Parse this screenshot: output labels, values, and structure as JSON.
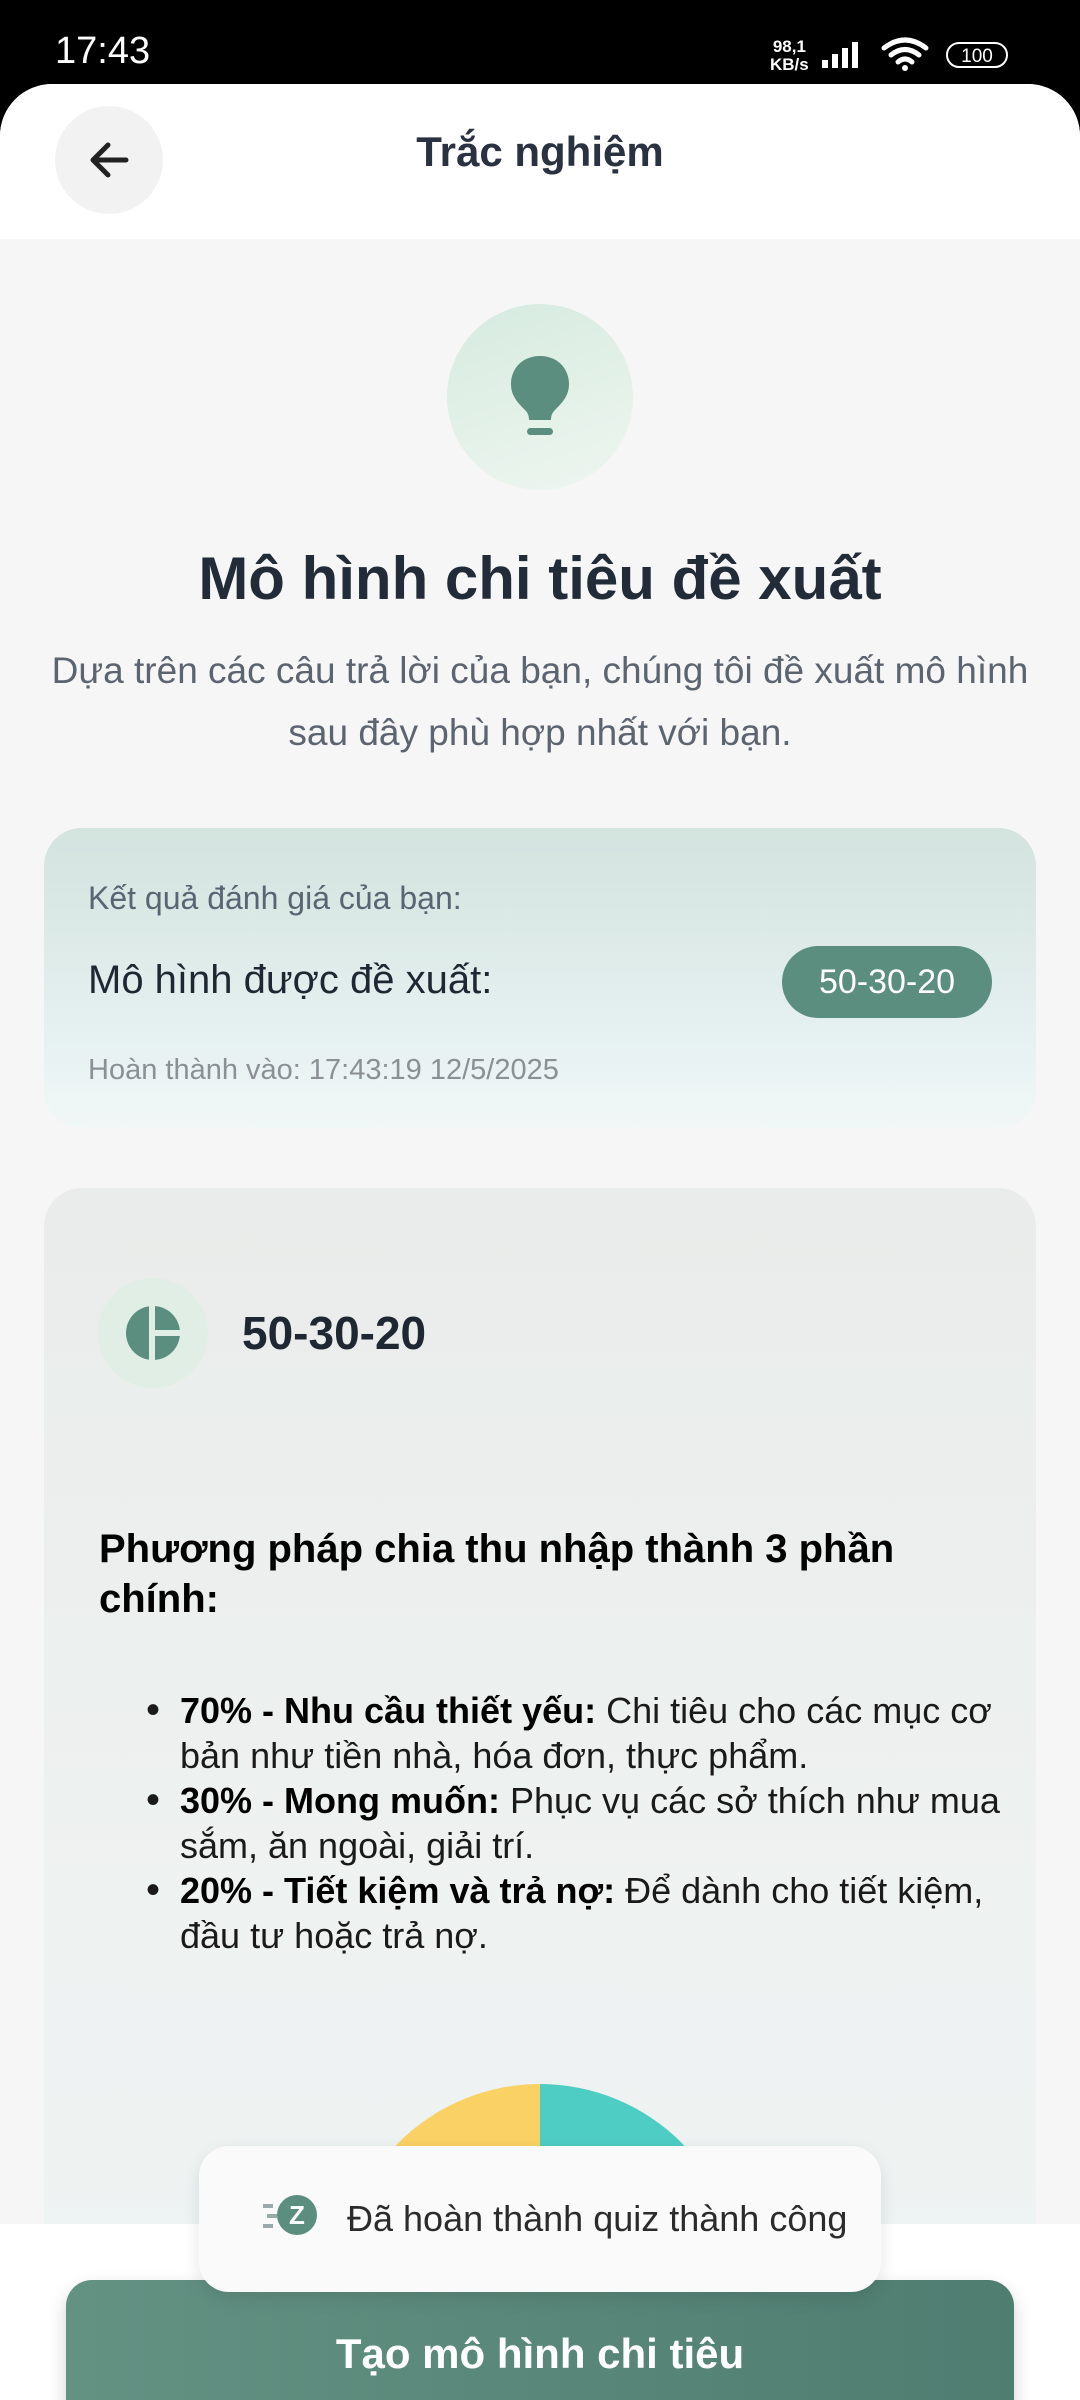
{
  "status": {
    "time": "17:43",
    "net_speed": "98,1",
    "net_unit": "KB/s",
    "battery": "100"
  },
  "header": {
    "title": "Trắc nghiệm"
  },
  "hero": {
    "title": "Mô hình chi tiêu đề xuất",
    "subtitle": "Dựa trên các câu trả lời của bạn, chúng tôi đề xuất mô hình sau đây phù hợp nhất với bạn."
  },
  "result": {
    "label": "Kết quả đánh giá của bạn:",
    "model_label": "Mô hình được đề xuất:",
    "model_value": "50-30-20",
    "completed": "Hoàn thành vào: 17:43:19 12/5/2025"
  },
  "detail": {
    "title": "50-30-20",
    "heading": "Phương pháp chia thu nhập thành 3 phần chính:",
    "bullets": [
      {
        "bold": "70% - Nhu cầu thiết yếu:",
        "text": " Chi tiêu cho các mục cơ bản như tiền nhà, hóa đơn, thực phẩm."
      },
      {
        "bold": "30% - Mong muốn:",
        "text": " Phục vụ các sở thích như mua sắm, ăn ngoài, giải trí."
      },
      {
        "bold": "20% - Tiết kiệm và trả nợ:",
        "text": " Để dành cho tiết kiệm, đầu tư hoặc trả nợ."
      }
    ],
    "pie_colors": [
      "#fad164",
      "#4ecdc4"
    ]
  },
  "toast": {
    "message": "Đã hoàn thành quiz thành công"
  },
  "cta": {
    "label": "Tạo mô hình chi tiêu"
  },
  "icons": [
    "back-arrow-icon",
    "lightbulb-icon",
    "pie-chart-icon",
    "toast-logo-icon",
    "wifi-icon",
    "signal-icon"
  ]
}
